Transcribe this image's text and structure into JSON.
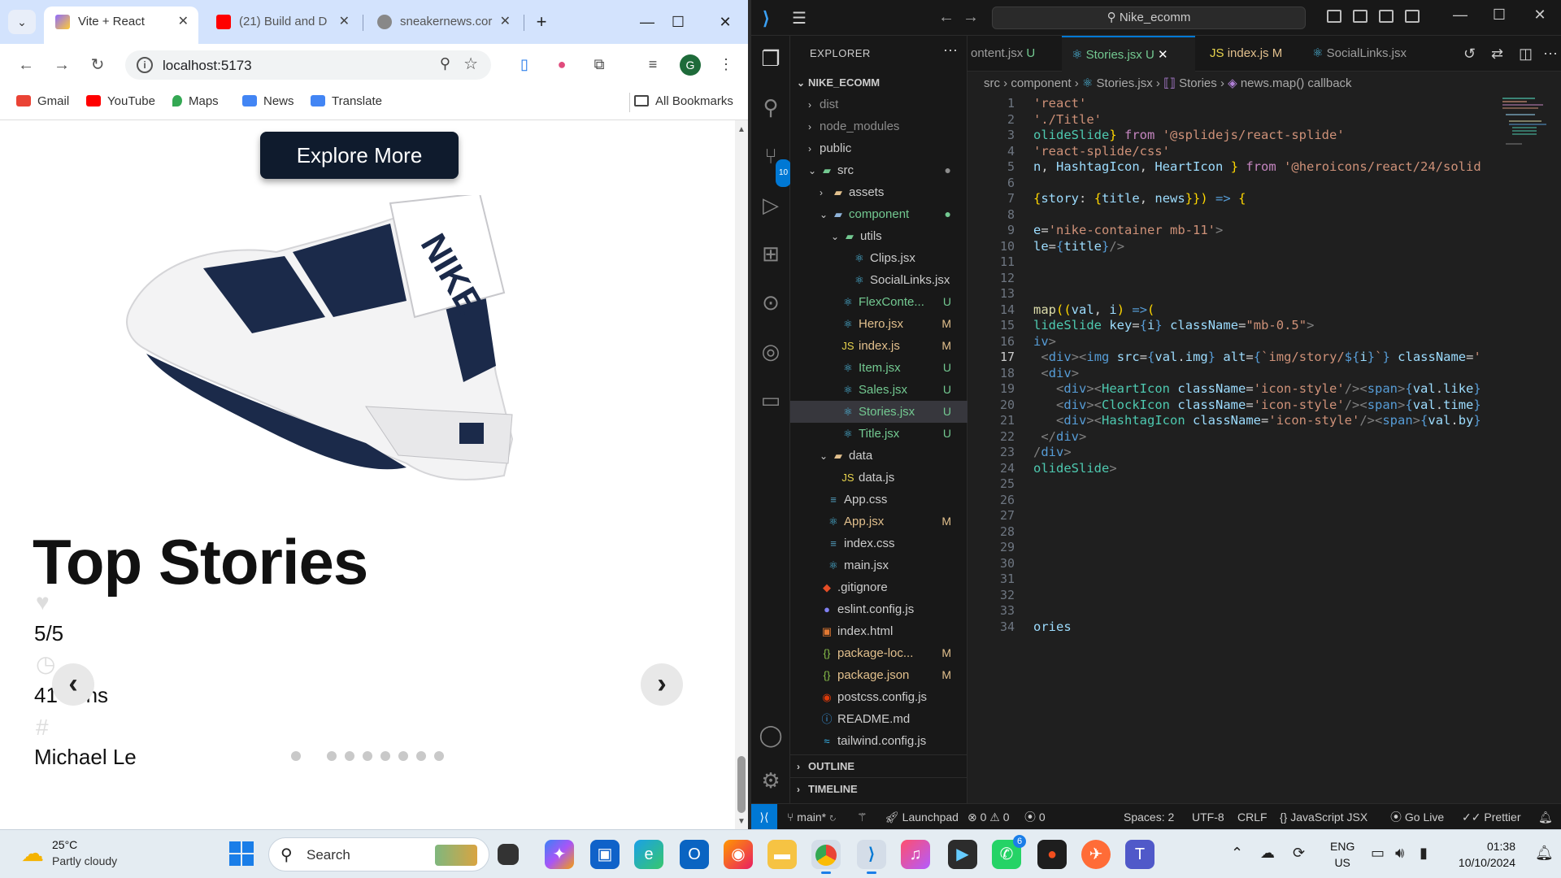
{
  "browser": {
    "tabs": [
      {
        "title": "Vite + React"
      },
      {
        "title": "(21) Build and D"
      },
      {
        "title": "sneakernews.cor"
      }
    ],
    "url": "localhost:5173",
    "avatar_initial": "G",
    "bookmarks": [
      "Gmail",
      "YouTube",
      "Maps",
      "News",
      "Translate"
    ],
    "all_bookmarks": "All Bookmarks"
  },
  "page": {
    "explore_button": "Explore More",
    "section_title": "Top Stories",
    "story": {
      "likes": "5/5",
      "time": "41 Mins",
      "by": "Michael Le"
    },
    "slider": {
      "dot_count": 9,
      "active_index": 0
    }
  },
  "vscode": {
    "command_center": "Nike_ecomm",
    "explorer_title": "EXPLORER",
    "root_folder": "NIKE_ECOMM",
    "tree": [
      {
        "label": "dist",
        "status": ""
      },
      {
        "label": "node_modules",
        "status": ""
      },
      {
        "label": "public",
        "status": ""
      },
      {
        "label": "src",
        "status": "●"
      },
      {
        "label": "assets",
        "status": ""
      },
      {
        "label": "component",
        "status": "●"
      },
      {
        "label": "utils",
        "status": ""
      },
      {
        "label": "Clips.jsx",
        "status": ""
      },
      {
        "label": "SocialLinks.jsx",
        "status": ""
      },
      {
        "label": "FlexConte...",
        "status": "U"
      },
      {
        "label": "Hero.jsx",
        "status": "M"
      },
      {
        "label": "index.js",
        "status": "M"
      },
      {
        "label": "Item.jsx",
        "status": "U"
      },
      {
        "label": "Sales.jsx",
        "status": "U"
      },
      {
        "label": "Stories.jsx",
        "status": "U"
      },
      {
        "label": "Title.jsx",
        "status": "U"
      },
      {
        "label": "data",
        "status": ""
      },
      {
        "label": "data.js",
        "status": ""
      },
      {
        "label": "App.css",
        "status": ""
      },
      {
        "label": "App.jsx",
        "status": "M"
      },
      {
        "label": "index.css",
        "status": ""
      },
      {
        "label": "main.jsx",
        "status": ""
      },
      {
        "label": ".gitignore",
        "status": ""
      },
      {
        "label": "eslint.config.js",
        "status": ""
      },
      {
        "label": "index.html",
        "status": ""
      },
      {
        "label": "package-loc...",
        "status": "M"
      },
      {
        "label": "package.json",
        "status": "M"
      },
      {
        "label": "postcss.config.js",
        "status": ""
      },
      {
        "label": "README.md",
        "status": ""
      },
      {
        "label": "tailwind.config.js",
        "status": ""
      }
    ],
    "outline": "OUTLINE",
    "timeline": "TIMELINE",
    "editor_tabs": [
      {
        "label": "ontent.jsx",
        "status": "U"
      },
      {
        "label": "Stories.jsx",
        "status": "U"
      },
      {
        "label": "index.js",
        "status": "M"
      },
      {
        "label": "SocialLinks.jsx",
        "status": ""
      }
    ],
    "breadcrumb": [
      "src",
      "component",
      "Stories.jsx",
      "Stories",
      "news.map() callback"
    ],
    "current_line": 17,
    "status": {
      "branch": "main*",
      "launchpad": "Launchpad",
      "errors": "0",
      "warnings": "0",
      "ports": "0",
      "spaces": "Spaces: 2",
      "encoding": "UTF-8",
      "eol": "CRLF",
      "language": "JavaScript JSX",
      "golive": "Go Live",
      "prettier": "Prettier"
    }
  },
  "taskbar": {
    "weather_temp": "25°C",
    "weather_desc": "Partly cloudy",
    "search": "Search",
    "lang": "ENG",
    "region": "US",
    "time": "01:38",
    "date": "10/10/2024",
    "whatsapp_badge": "6"
  }
}
